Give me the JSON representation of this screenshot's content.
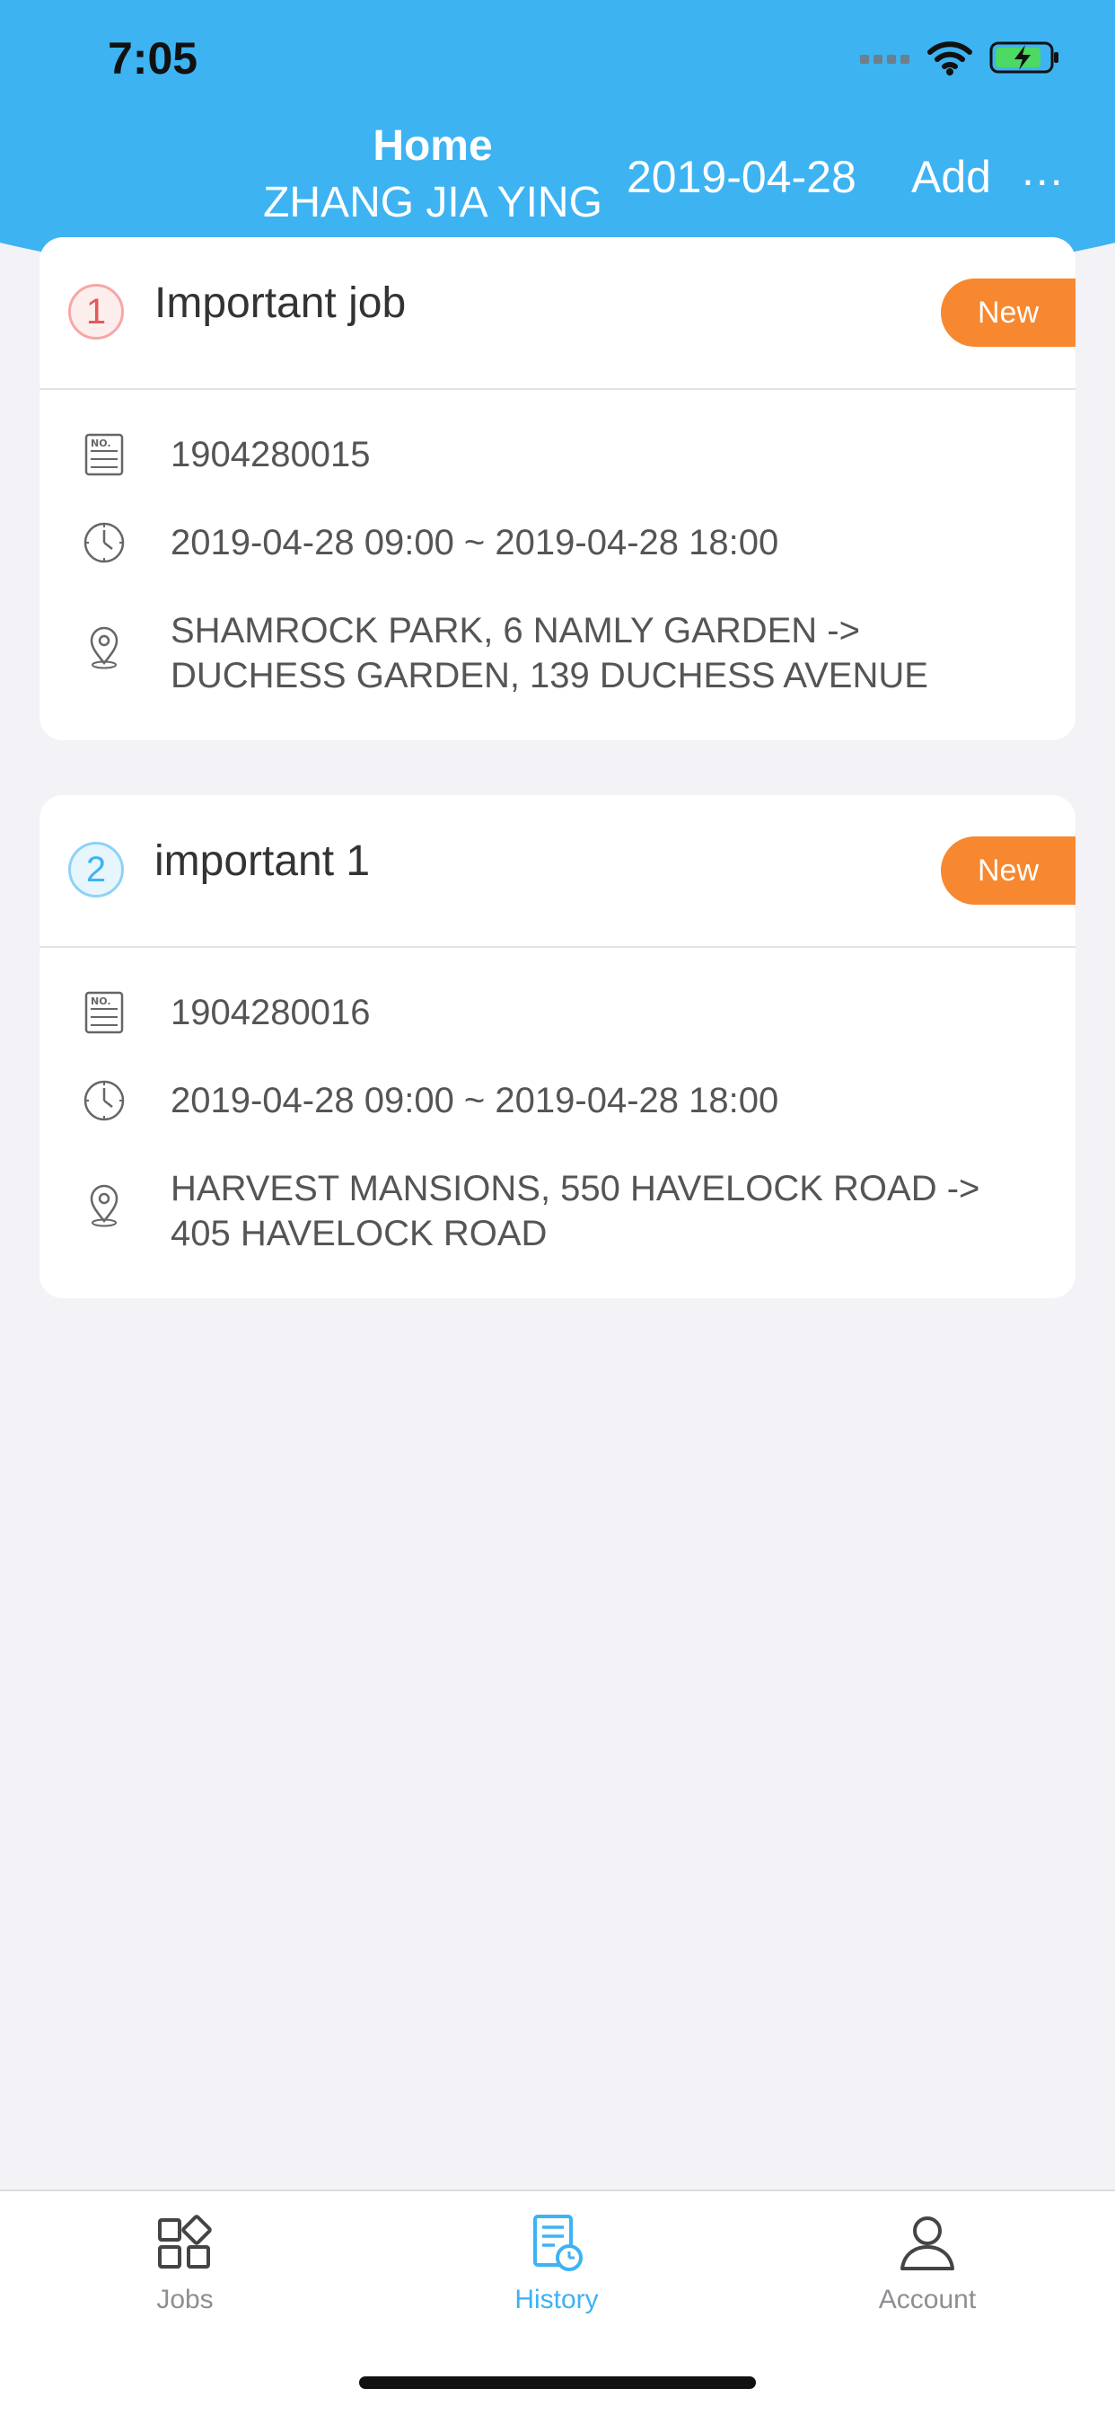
{
  "status_bar": {
    "time": "7:05"
  },
  "nav": {
    "title": "Home",
    "subtitle": "ZHANG JIA YING",
    "date": "2019-04-28",
    "add_label": "Add",
    "more_label": "..."
  },
  "jobs": [
    {
      "index": "1",
      "title": "Important job",
      "status": "New",
      "number": "1904280015",
      "time_range": "2019-04-28 09:00 ~ 2019-04-28 18:00",
      "address_line1": "SHAMROCK PARK, 6 NAMLY GARDEN ->",
      "address_line2": "DUCHESS GARDEN, 139 DUCHESS AVENUE"
    },
    {
      "index": "2",
      "title": "important 1",
      "status": "New",
      "number": "1904280016",
      "time_range": "2019-04-28 09:00 ~ 2019-04-28 18:00",
      "address_line1": "HARVEST MANSIONS, 550 HAVELOCK ROAD ->",
      "address_line2": "405 HAVELOCK ROAD"
    }
  ],
  "tabbar": {
    "items": [
      {
        "label": "Jobs",
        "icon": "grid-icon",
        "active": false
      },
      {
        "label": "History",
        "icon": "history-document-icon",
        "active": true
      },
      {
        "label": "Account",
        "icon": "person-icon",
        "active": false
      }
    ]
  },
  "colors": {
    "header": "#3db3f2",
    "badge": "#f7882f",
    "active_tab": "#3db3f2",
    "inactive_tab": "#8e8e93"
  }
}
